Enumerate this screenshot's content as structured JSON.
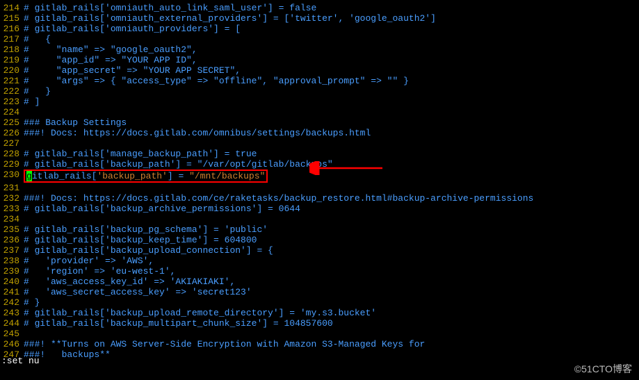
{
  "lines": [
    {
      "n": 214,
      "t": "# gitlab_rails['omniauth_auto_link_saml_user'] = false"
    },
    {
      "n": 215,
      "t": "# gitlab_rails['omniauth_external_providers'] = ['twitter', 'google_oauth2']"
    },
    {
      "n": 216,
      "t": "# gitlab_rails['omniauth_providers'] = ["
    },
    {
      "n": 217,
      "t": "#   {"
    },
    {
      "n": 218,
      "t": "#     \"name\" => \"google_oauth2\","
    },
    {
      "n": 219,
      "t": "#     \"app_id\" => \"YOUR APP ID\","
    },
    {
      "n": 220,
      "t": "#     \"app_secret\" => \"YOUR APP SECRET\","
    },
    {
      "n": 221,
      "t": "#     \"args\" => { \"access_type\" => \"offline\", \"approval_prompt\" => \"\" }"
    },
    {
      "n": 222,
      "t": "#   }"
    },
    {
      "n": 223,
      "t": "# ]"
    },
    {
      "n": 224,
      "t": ""
    },
    {
      "n": 225,
      "t": "### Backup Settings"
    },
    {
      "n": 226,
      "t": "###! Docs: https://docs.gitlab.com/omnibus/settings/backups.html"
    },
    {
      "n": 227,
      "t": ""
    },
    {
      "n": 228,
      "t": "# gitlab_rails['manage_backup_path'] = true"
    },
    {
      "n": 229,
      "t": "# gitlab_rails['backup_path'] = \"/var/opt/gitlab/backups\""
    },
    {
      "n": 230,
      "hl": true,
      "cursor": "g",
      "pre": "itlab_rails[",
      "str1": "'backup_path'",
      "mid": "] = ",
      "str2": "\"/mnt/backups\""
    },
    {
      "n": 231,
      "t": ""
    },
    {
      "n": 232,
      "t": "###! Docs: https://docs.gitlab.com/ce/raketasks/backup_restore.html#backup-archive-permissions"
    },
    {
      "n": 233,
      "t": "# gitlab_rails['backup_archive_permissions'] = 0644"
    },
    {
      "n": 234,
      "t": ""
    },
    {
      "n": 235,
      "t": "# gitlab_rails['backup_pg_schema'] = 'public'"
    },
    {
      "n": 236,
      "t": "# gitlab_rails['backup_keep_time'] = 604800"
    },
    {
      "n": 237,
      "t": "# gitlab_rails['backup_upload_connection'] = {"
    },
    {
      "n": 238,
      "t": "#   'provider' => 'AWS',"
    },
    {
      "n": 239,
      "t": "#   'region' => 'eu-west-1',"
    },
    {
      "n": 240,
      "t": "#   'aws_access_key_id' => 'AKIAKIAKI',"
    },
    {
      "n": 241,
      "t": "#   'aws_secret_access_key' => 'secret123'"
    },
    {
      "n": 242,
      "t": "# }"
    },
    {
      "n": 243,
      "t": "# gitlab_rails['backup_upload_remote_directory'] = 'my.s3.bucket'"
    },
    {
      "n": 244,
      "t": "# gitlab_rails['backup_multipart_chunk_size'] = 104857600"
    },
    {
      "n": 245,
      "t": ""
    },
    {
      "n": 246,
      "t": "###! **Turns on AWS Server-Side Encryption with Amazon S3-Managed Keys for"
    },
    {
      "n": 247,
      "t": "###!   backups**"
    }
  ],
  "status": ":set nu",
  "watermark": "©51CTO博客"
}
